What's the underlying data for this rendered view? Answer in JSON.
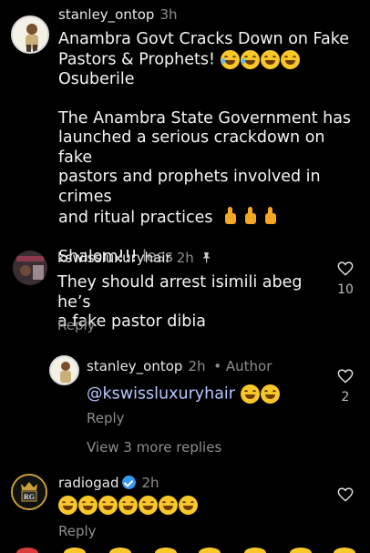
{
  "comments": [
    {
      "username": "stanley_ontop",
      "time": "3h",
      "text_lines": [
        "Anambra Govt Cracks Down on Fake",
        "Pastors & Prophets!",
        "Osuberile",
        "",
        "The Anambra State Government has",
        "launched a serious crackdown on fake",
        "pastors and prophets involved in crimes",
        "and ritual practices",
        "",
        "Shalom!!!"
      ],
      "less_label": "less"
    },
    {
      "username": "kswissluxuryhair",
      "time": "2h",
      "text_lines": [
        "They should arrest isimili abeg he’s",
        "a fake pastor dibia"
      ],
      "reply_label": "Reply",
      "likes": "10"
    },
    {
      "username": "stanley_ontop",
      "time": "2h",
      "author_tag": "• Author",
      "mention": "@kswissluxuryhair",
      "reply_label": "Reply",
      "likes": "2",
      "view_more": "View 3 more replies"
    },
    {
      "username": "radiogad",
      "time": "2h",
      "reply_label": "Reply"
    }
  ],
  "icons": {
    "heart": "heart-outline-icon",
    "pin": "pin-icon",
    "verified": "verified-badge-icon"
  },
  "colors": {
    "background": "#000000",
    "text": "#f5f5f5",
    "muted": "#8e8e8e",
    "mention": "#b4c8ff",
    "verified": "#3897f0"
  }
}
